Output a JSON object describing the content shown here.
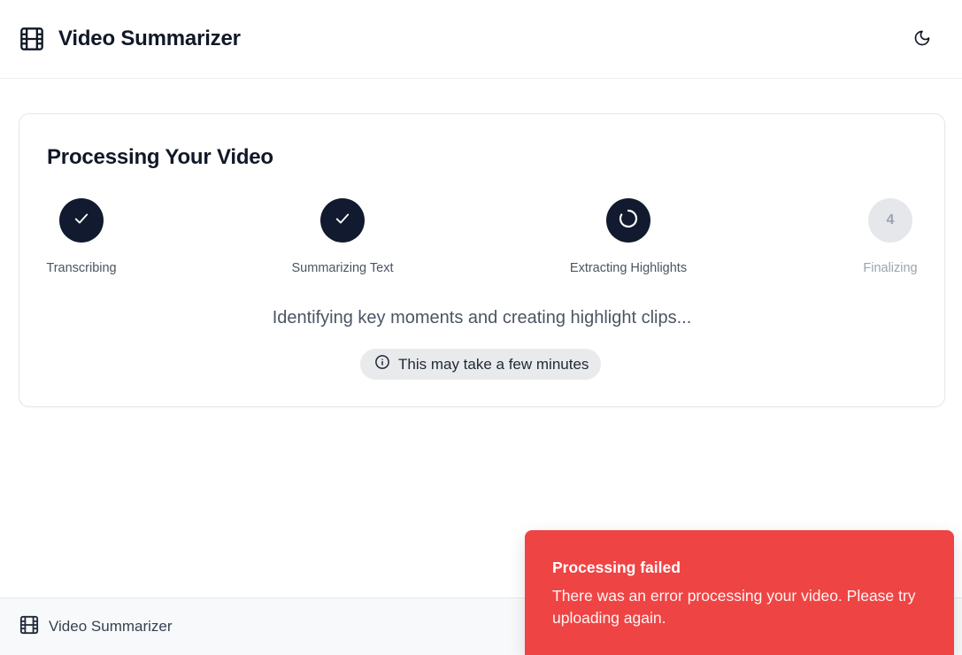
{
  "app": {
    "title": "Video Summarizer"
  },
  "header": {
    "logo_icon": "film-icon",
    "theme_toggle_icon": "moon-icon"
  },
  "processing": {
    "title": "Processing Your Video",
    "steps": [
      {
        "label": "Transcribing",
        "state": "done",
        "icon": "check-icon"
      },
      {
        "label": "Summarizing Text",
        "state": "done",
        "icon": "check-icon"
      },
      {
        "label": "Extracting Highlights",
        "state": "active",
        "icon": "spinner-icon"
      },
      {
        "label": "Finalizing",
        "state": "pending",
        "number": "4"
      }
    ],
    "status_message": "Identifying key moments and creating highlight clips...",
    "note": "This may take a few minutes",
    "note_icon": "info-icon"
  },
  "footer": {
    "title": "Video Summarizer",
    "logo_icon": "film-icon"
  },
  "toast": {
    "title": "Processing failed",
    "message": "There was an error processing your video. Please try uploading again.",
    "color": "#ef4444"
  },
  "colors": {
    "step_complete": "#111a2e",
    "step_pending": "#e5e7eb"
  }
}
